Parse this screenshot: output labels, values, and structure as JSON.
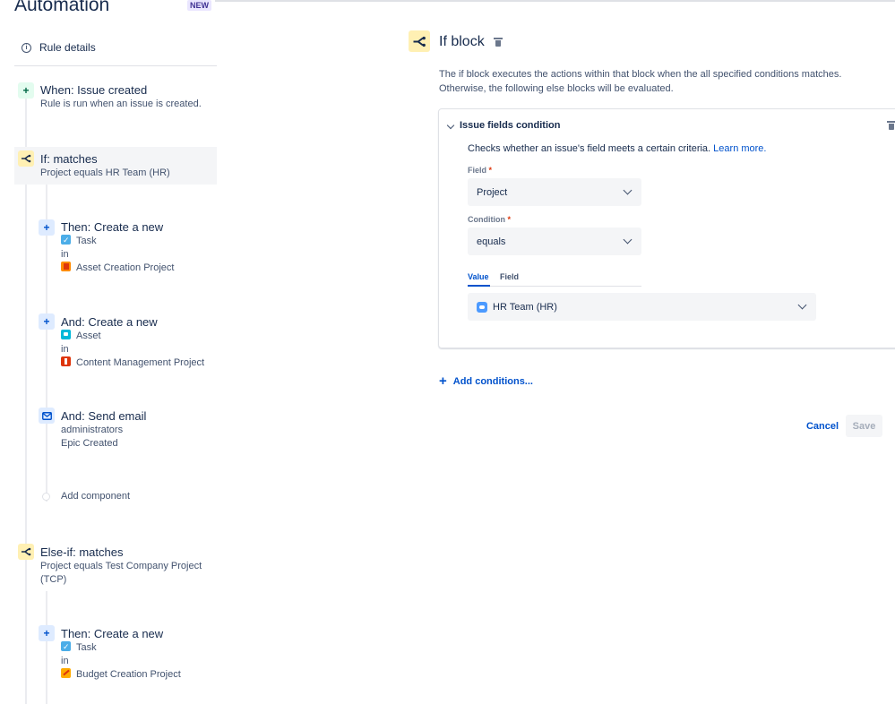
{
  "app": {
    "title": "Automation",
    "badge": "NEW"
  },
  "sidebar": {
    "rule_details": "Rule details",
    "trigger": {
      "title": "When: Issue created",
      "sub": "Rule is run when an issue is created."
    },
    "if": {
      "title": "If: matches",
      "sub": "Project equals HR Team (HR)"
    },
    "then1": {
      "title": "Then: Create a new",
      "type": "Task",
      "in": "in",
      "project": "Asset Creation Project"
    },
    "and1": {
      "title": "And: Create a new",
      "type": "Asset",
      "in": "in",
      "project": "Content Management Project"
    },
    "and2": {
      "title": "And: Send email",
      "line1": "administrators",
      "line2": "Epic Created"
    },
    "add_component": "Add component",
    "elseif": {
      "title": "Else-if: matches",
      "sub": "Project equals Test Company Project (TCP)"
    },
    "then2": {
      "title": "Then: Create a new",
      "type": "Task",
      "in": "in",
      "project": "Budget Creation Project"
    }
  },
  "panel": {
    "title": "If block",
    "description": "The if block executes the actions within that block when the all specified conditions matches. Otherwise, the following else blocks will be evaluated.",
    "condition": {
      "title": "Issue fields condition",
      "description": "Checks whether an issue's field meets a certain criteria.",
      "learn_more": "Learn more.",
      "field_label": "Field",
      "field_value": "Project",
      "condition_label": "Condition",
      "condition_value": "equals",
      "required_mark": "*",
      "tab_value": "Value",
      "tab_field": "Field",
      "value": "HR Team (HR)"
    },
    "add_conditions": "Add conditions...",
    "cancel": "Cancel",
    "save": "Save"
  },
  "colors": {
    "accent": "#0052cc",
    "if_icon_bg": "#fff0b3",
    "trigger_icon_bg": "#e3fcef"
  }
}
